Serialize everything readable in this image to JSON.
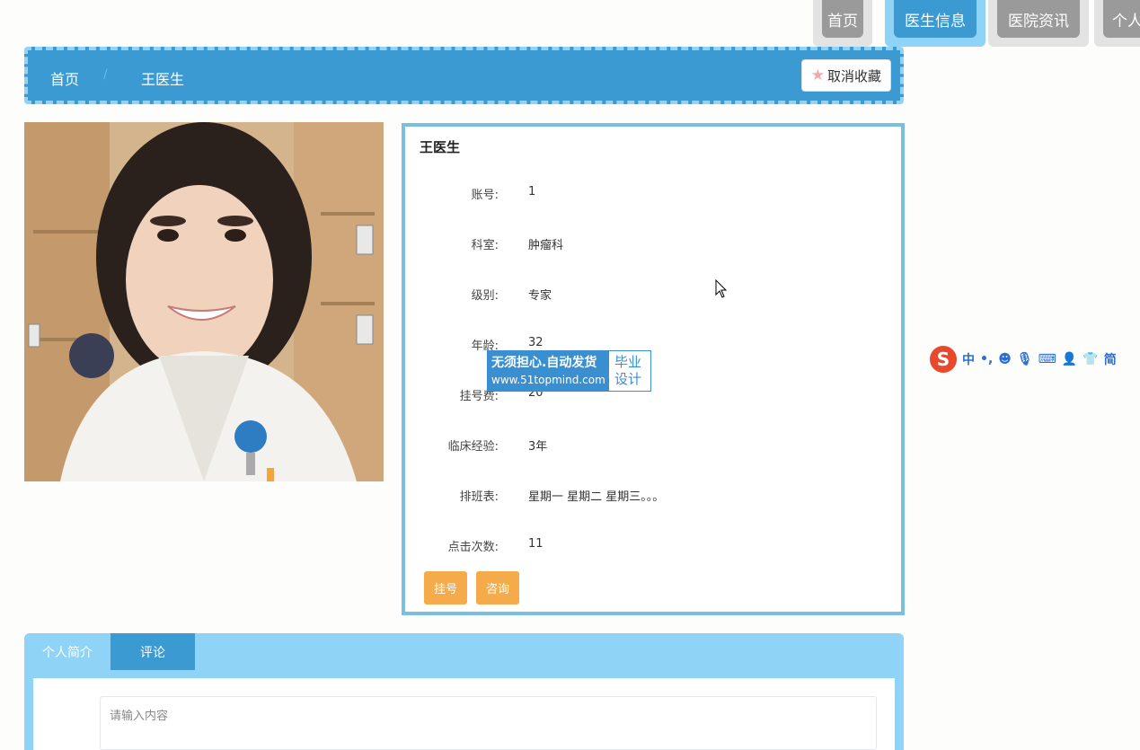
{
  "nav": {
    "items": [
      {
        "label": "首页"
      },
      {
        "label": "医生信息"
      },
      {
        "label": "医院资讯"
      },
      {
        "label": "个人"
      }
    ]
  },
  "breadcrumb": {
    "home": "首页",
    "separator": "/",
    "current": "王医生"
  },
  "favorite_button": {
    "label": "取消收藏",
    "icon": "star-icon"
  },
  "doctor": {
    "name": "王医生",
    "fields": [
      {
        "label": "账号:",
        "value": "1"
      },
      {
        "label": "科室:",
        "value": "肿瘤科"
      },
      {
        "label": "级别:",
        "value": "专家"
      },
      {
        "label": "年龄:",
        "value": "32"
      },
      {
        "label": "挂号费:",
        "value": "20"
      },
      {
        "label": "临床经验:",
        "value": "3年"
      },
      {
        "label": "排班表:",
        "value": "星期一 星期二 星期三。。。"
      },
      {
        "label": "点击次数:",
        "value": "11"
      }
    ],
    "actions": {
      "register": "挂号",
      "consult": "咨询"
    }
  },
  "watermark": {
    "line1": "无须担心.自动发货",
    "line2": "www.51topmind.com",
    "side": "毕业\n设计"
  },
  "ime_toolbar": {
    "chars": [
      "中",
      "•,",
      "简"
    ]
  },
  "tabs": {
    "items": [
      {
        "label": "个人简介"
      },
      {
        "label": "评论"
      }
    ],
    "active": "评论"
  },
  "comment": {
    "placeholder": "请输入内容"
  },
  "colors": {
    "primary": "#3a9ad1",
    "light": "#8fd3f7",
    "orange": "#f6ab4a",
    "gray_tab": "#9a9a9a"
  }
}
